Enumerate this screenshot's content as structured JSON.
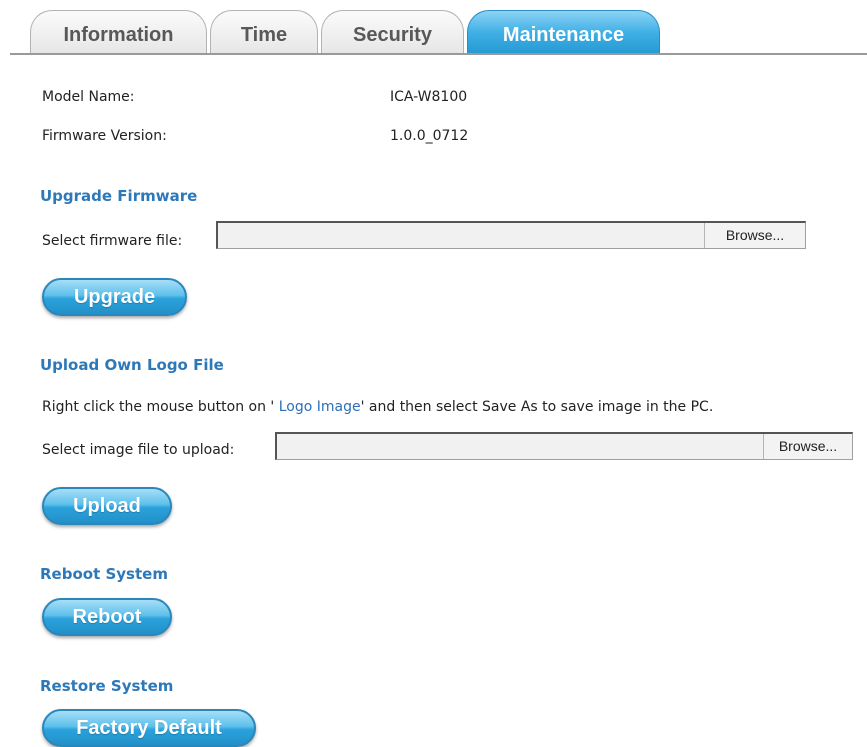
{
  "tabs": [
    {
      "label": "Information",
      "active": false
    },
    {
      "label": "Time",
      "active": false
    },
    {
      "label": "Security",
      "active": false
    },
    {
      "label": "Maintenance",
      "active": true
    }
  ],
  "info": {
    "model_name_label": "Model Name:",
    "model_name_value": "ICA-W8100",
    "firmware_version_label": "Firmware Version:",
    "firmware_version_value": "1.0.0_0712"
  },
  "upgrade_firmware": {
    "title": "Upgrade Firmware",
    "select_label": "Select firmware file:",
    "file_value": "",
    "browse_label": "Browse...",
    "button_label": "Upgrade"
  },
  "upload_logo": {
    "title": "Upload Own Logo File",
    "hint_prefix": "Right click the mouse button on '",
    "hint_link": " Logo Image",
    "hint_suffix": "' and then select Save As to save image in the PC.",
    "select_label": "Select image file to upload:",
    "file_value": "",
    "browse_label": "Browse...",
    "button_label": "Upload"
  },
  "reboot": {
    "title": "Reboot System",
    "button_label": "Reboot"
  },
  "restore": {
    "title": "Restore System",
    "button_label": "Factory Default"
  },
  "colors": {
    "accent_blue": "#2d78b8",
    "active_tab": "#3fb0e6",
    "button_blue": "#2aa2dc"
  }
}
